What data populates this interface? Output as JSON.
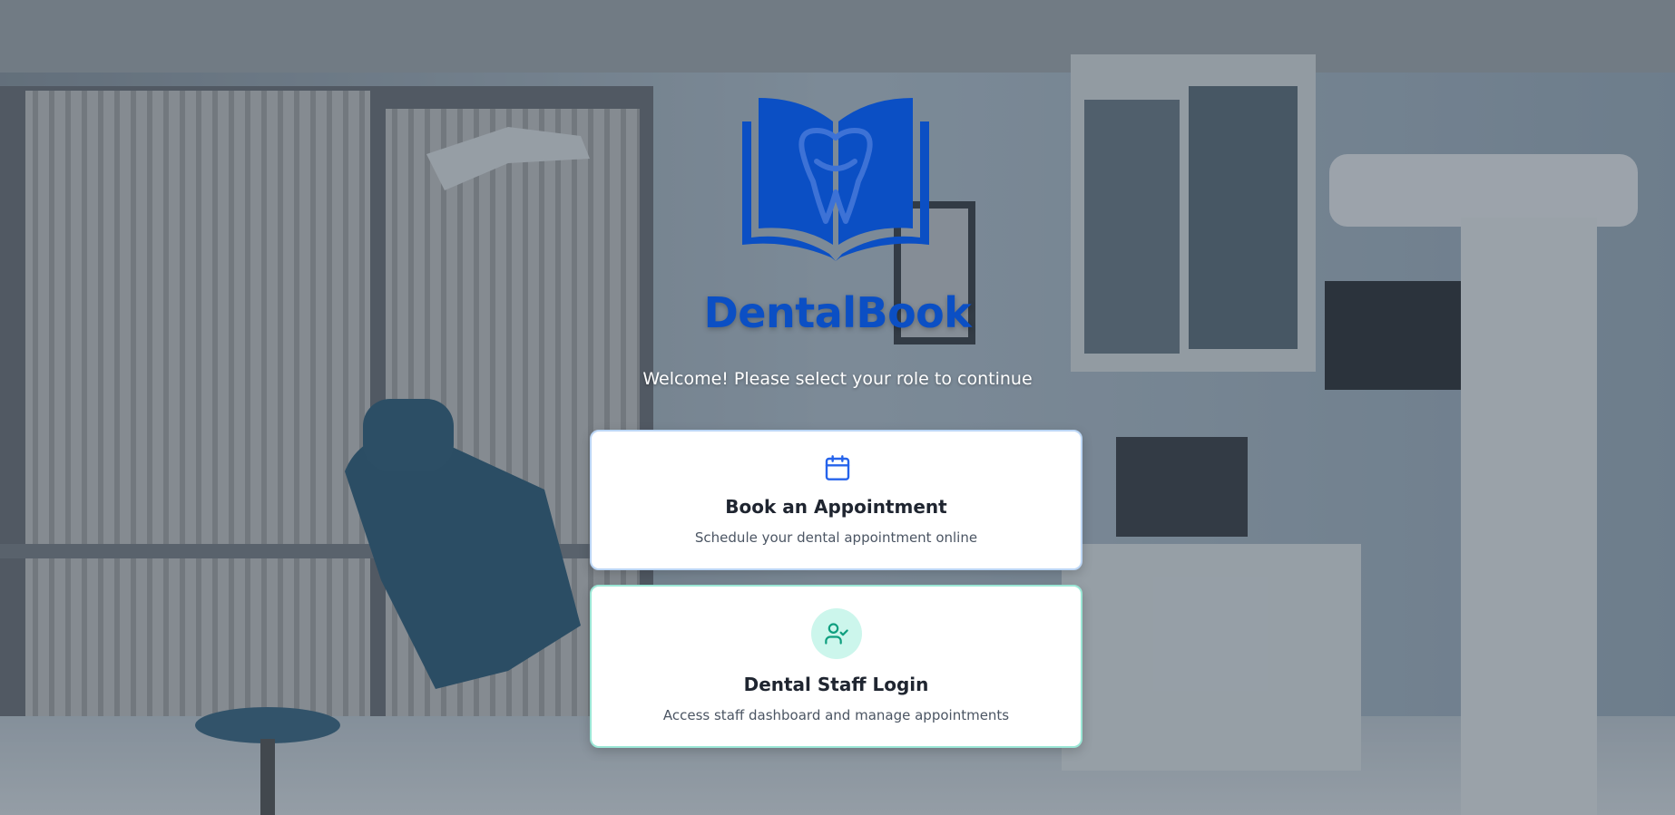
{
  "app": {
    "brand_name": "DentalBook",
    "welcome_text": "Welcome! Please select your role to continue"
  },
  "cards": {
    "book": {
      "icon": "calendar-icon",
      "title": "Book an Appointment",
      "description": "Schedule your dental appointment online"
    },
    "staff": {
      "icon": "user-check-icon",
      "title": "Dental Staff Login",
      "description": "Access staff dashboard and manage appointments"
    }
  },
  "colors": {
    "brand_blue": "#0b4fc4",
    "calendar_icon_blue": "#2563eb",
    "staff_icon_green": "#0f9f7f",
    "staff_icon_bg": "#ccf6ec",
    "card_book_border": "#bcd6f5",
    "card_staff_border": "#9be7d6"
  }
}
